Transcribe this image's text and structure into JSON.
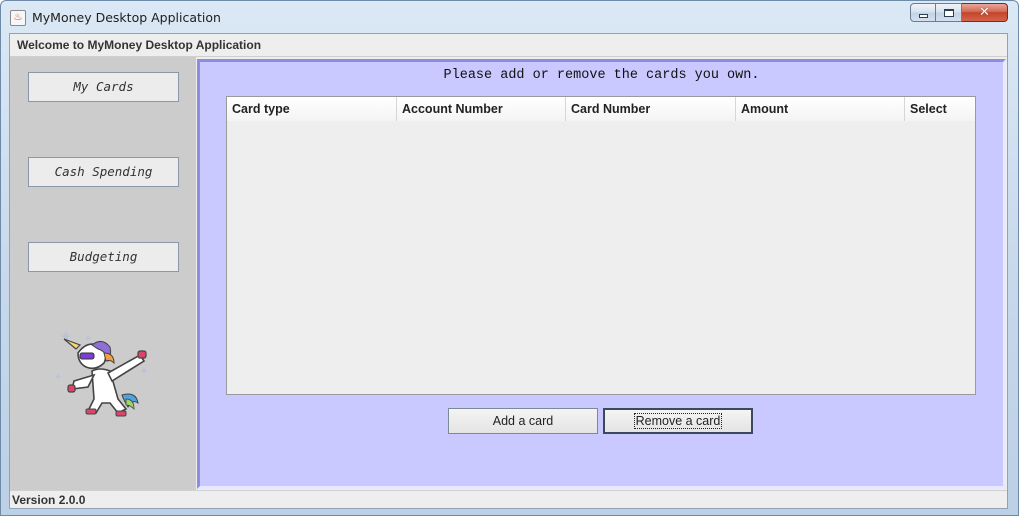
{
  "window": {
    "title": "MyMoney Desktop Application",
    "app_icon_glyph": "♨",
    "controls": {
      "minimize": "minimize",
      "maximize": "maximize",
      "close": "✕"
    }
  },
  "header": {
    "welcome": "Welcome to MyMoney Desktop Application"
  },
  "sidebar": {
    "items": [
      {
        "label": "My Cards"
      },
      {
        "label": "Cash Spending"
      },
      {
        "label": "Budgeting"
      }
    ],
    "mascot": "dabbing-unicorn-icon"
  },
  "main": {
    "heading": "Please add or remove the cards you own.",
    "table": {
      "columns": [
        "Card type",
        "Account Number",
        "Card Number",
        "Amount",
        "Select"
      ],
      "rows": []
    },
    "buttons": {
      "add": "Add a card",
      "remove": "Remove a card"
    }
  },
  "status": {
    "version": "Version 2.0.0"
  },
  "colors": {
    "main_panel_bg": "#c9c9ff",
    "sidebar_bg": "#cccccc",
    "client_bg": "#eeeeee"
  }
}
